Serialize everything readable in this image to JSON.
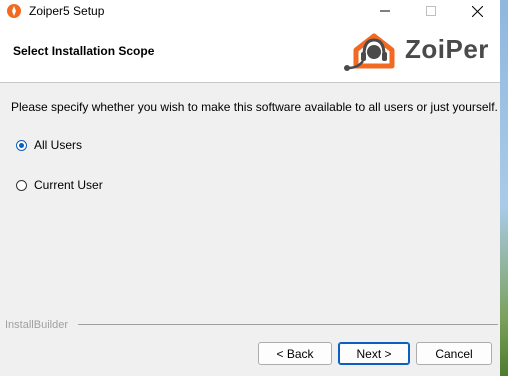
{
  "window": {
    "title": "Zoiper5 Setup",
    "controls": {
      "minimize": "minimize-icon",
      "maximize": "maximize-icon",
      "close": "close-icon"
    }
  },
  "header": {
    "title": "Select Installation Scope",
    "logo_text": "ZoiPer",
    "logo_color": "#f26a21"
  },
  "main": {
    "instructions": "Please specify whether you wish to make this software available to all users or just yourself.",
    "options": [
      {
        "label": "All Users",
        "selected": true
      },
      {
        "label": "Current User",
        "selected": false
      }
    ]
  },
  "footer": {
    "brand": "InstallBuilder",
    "back_label": "< Back",
    "next_label": "Next >",
    "cancel_label": "Cancel"
  },
  "colors": {
    "accent": "#0a5fc0",
    "window_bg": "#f0f0f0"
  }
}
